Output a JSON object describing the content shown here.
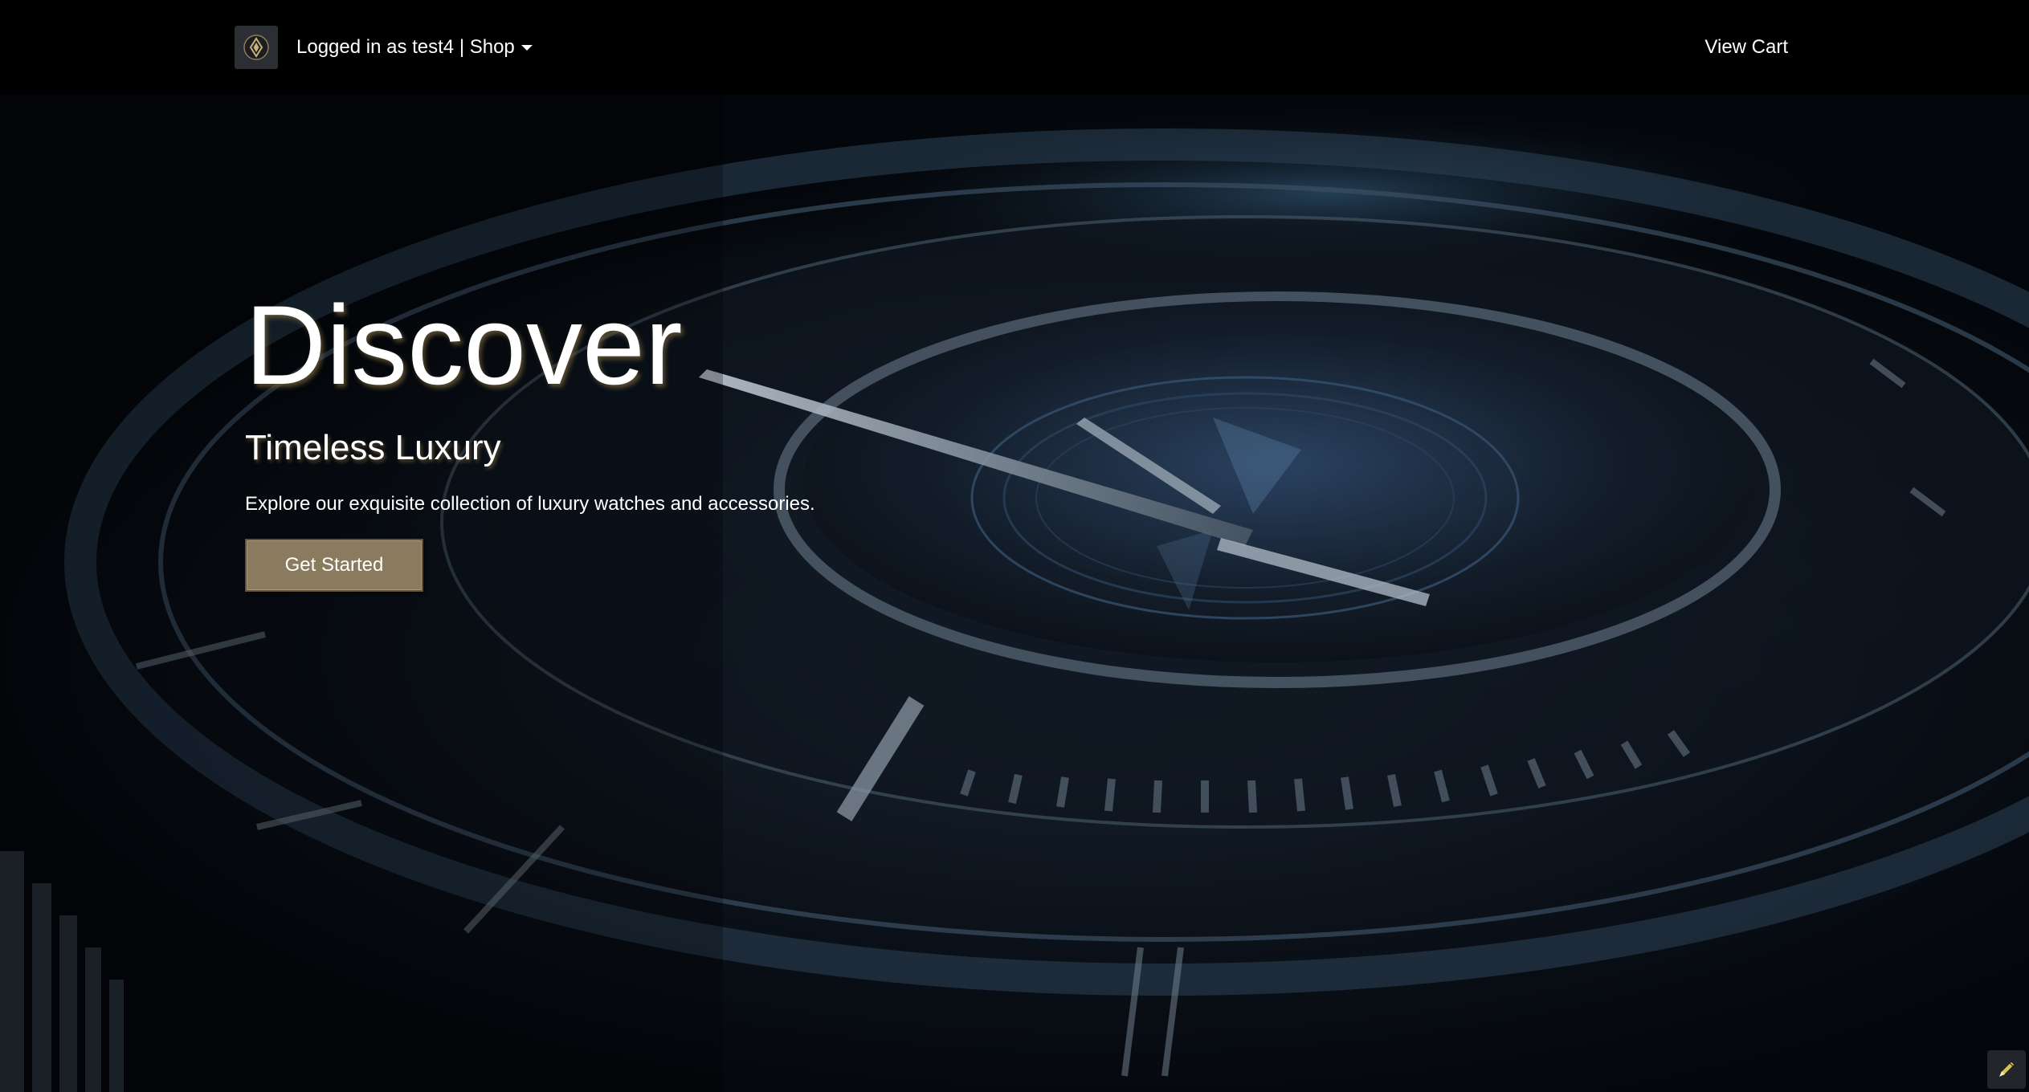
{
  "navbar": {
    "logo_icon": "brand-logo-icon",
    "user_menu_label": "Logged in as test4 | Shop",
    "cart_label": "View Cart"
  },
  "hero": {
    "title": "Discover",
    "subtitle": "Timeless Luxury",
    "description": "Explore our exquisite collection of luxury watches and accessories.",
    "cta_label": "Get Started",
    "background": "watch-face-closeup-image"
  },
  "corner_tool": {
    "icon": "pen-icon"
  },
  "colors": {
    "navbar_bg": "#000000",
    "accent_button": "#8a7a5e",
    "text": "#ffffff"
  }
}
